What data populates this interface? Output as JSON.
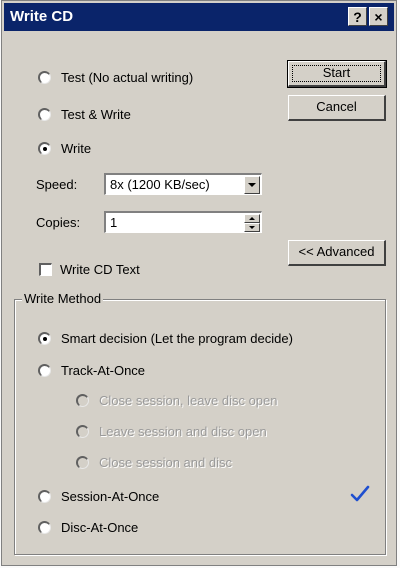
{
  "window": {
    "title": "Write CD",
    "help_button": "?",
    "close_button": "×"
  },
  "mode": {
    "options": [
      {
        "label": "Test  (No actual writing)",
        "selected": false
      },
      {
        "label": "Test & Write",
        "selected": false
      },
      {
        "label": "Write",
        "selected": true
      }
    ]
  },
  "buttons": {
    "start": "Start",
    "cancel": "Cancel",
    "advanced": "<< Advanced"
  },
  "speed": {
    "label": "Speed:",
    "value": "8x (1200 KB/sec)"
  },
  "copies": {
    "label": "Copies:",
    "value": "1"
  },
  "cd_text": {
    "label": "Write CD Text",
    "checked": false
  },
  "write_method": {
    "title": "Write Method",
    "options": [
      {
        "label": "Smart decision (Let the program decide)",
        "selected": true,
        "enabled": true
      },
      {
        "label": "Track-At-Once",
        "selected": false,
        "enabled": true
      },
      {
        "label": "Close session, leave disc open",
        "selected": false,
        "enabled": false
      },
      {
        "label": "Leave session and disc open",
        "selected": false,
        "enabled": false
      },
      {
        "label": "Close session and disc",
        "selected": false,
        "enabled": false
      },
      {
        "label": "Session-At-Once",
        "selected": false,
        "enabled": true
      },
      {
        "label": "Disc-At-Once",
        "selected": false,
        "enabled": true
      }
    ],
    "recommended_icon": "checkmark-icon"
  },
  "colors": {
    "titlebar": "#0a246a",
    "face": "#d4d0c8",
    "checkmark": "#1f4fcf"
  }
}
